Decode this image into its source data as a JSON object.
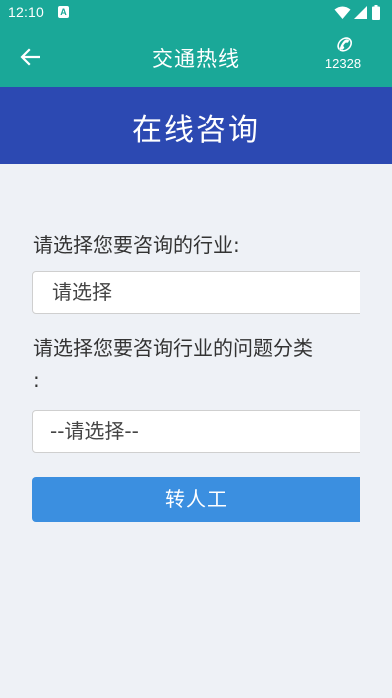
{
  "status_bar": {
    "time": "12:10",
    "app_badge": "A"
  },
  "app_bar": {
    "title": "交通热线",
    "hotline_icon": "✆",
    "hotline_number": "12328"
  },
  "banner": {
    "title": "在线咨询"
  },
  "form": {
    "industry_label": "请选择您要咨询的行业:",
    "industry_select_value": "请选择",
    "category_label": "请选择您要咨询行业的问题分类",
    "category_label_tail": ":",
    "category_select_value": "--请选择--",
    "submit_label": "转人工"
  },
  "colors": {
    "app_bar": "#1aa898",
    "banner": "#2c49b2",
    "button": "#3b8fe0",
    "background": "#eef1f6"
  }
}
